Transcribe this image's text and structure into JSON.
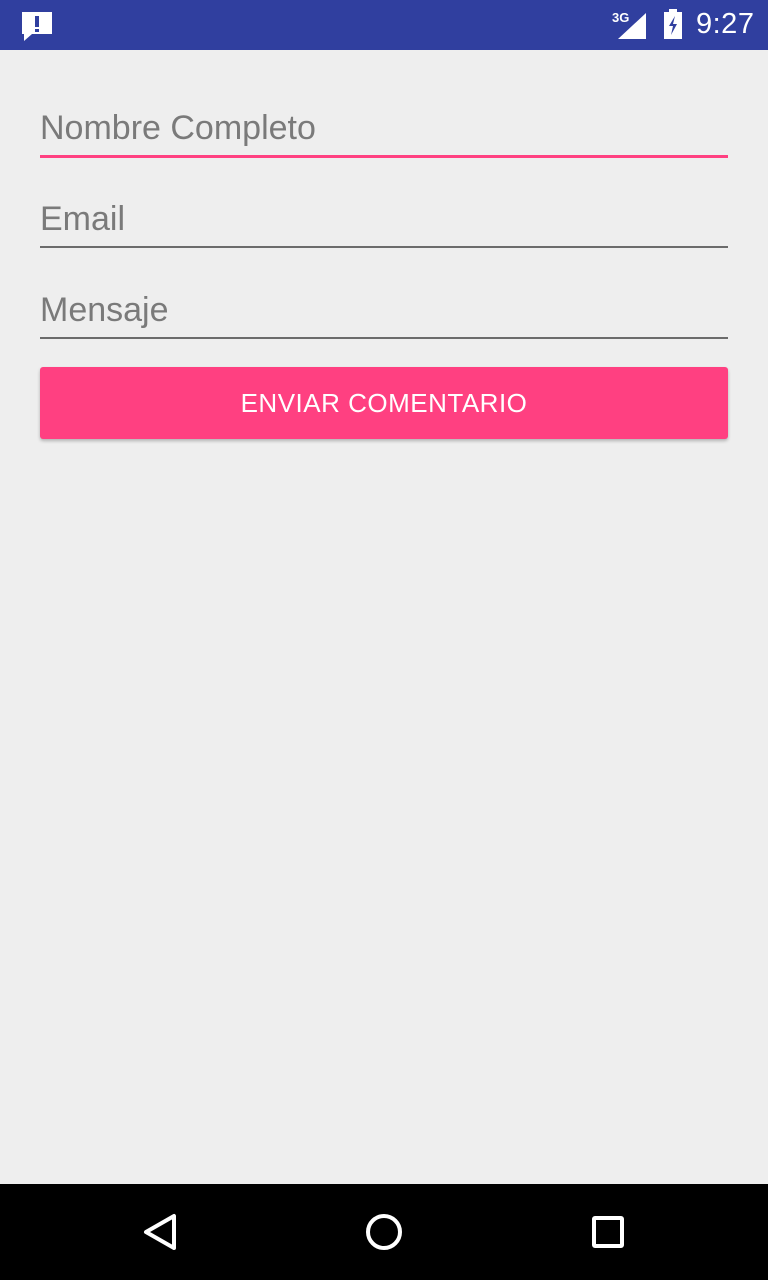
{
  "status_bar": {
    "network": "3G",
    "time": "9:27",
    "icons": [
      "alert-icon",
      "signal-icon",
      "battery-icon"
    ]
  },
  "form": {
    "fields": [
      {
        "name": "nombre",
        "placeholder": "Nombre Completo",
        "value": "",
        "focused": true
      },
      {
        "name": "email",
        "placeholder": "Email",
        "value": "",
        "focused": false
      },
      {
        "name": "mensaje",
        "placeholder": "Mensaje",
        "value": "",
        "focused": false
      }
    ],
    "submit_label": "ENVIAR COMENTARIO"
  },
  "nav_bar": {
    "icons": [
      "back-icon",
      "home-icon",
      "recents-icon"
    ]
  },
  "colors": {
    "status_bar": "#303f9f",
    "accent": "#ff4081",
    "background": "#eeeeee",
    "nav_bar": "#000000"
  }
}
